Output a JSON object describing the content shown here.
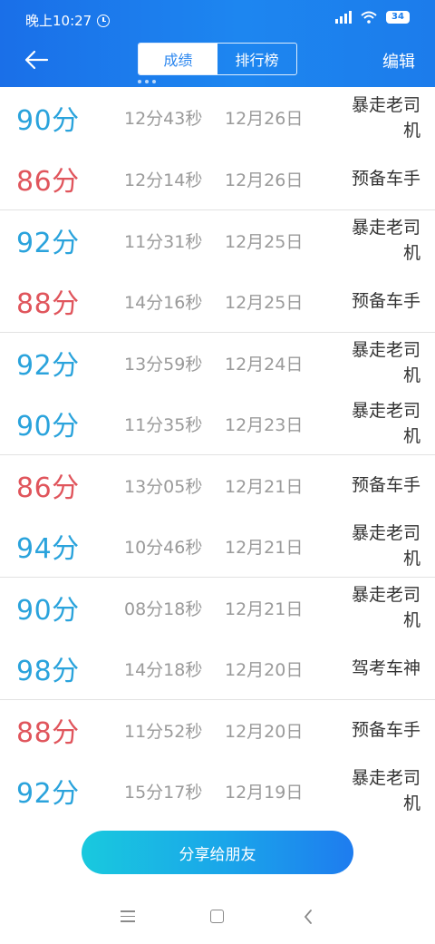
{
  "status_bar": {
    "time": "晚上10:27",
    "battery": "34"
  },
  "nav": {
    "tabs": [
      {
        "label": "成绩",
        "active": true
      },
      {
        "label": "排行榜",
        "active": false
      }
    ],
    "edit_label": "编辑"
  },
  "records": [
    {
      "score": "90分",
      "duration": "12分43秒",
      "date": "12月26日",
      "title": "暴走老司机",
      "color": "blue"
    },
    {
      "score": "86分",
      "duration": "12分14秒",
      "date": "12月26日",
      "title": "预备车手",
      "color": "red"
    },
    {
      "score": "92分",
      "duration": "11分31秒",
      "date": "12月25日",
      "title": "暴走老司机",
      "color": "blue"
    },
    {
      "score": "88分",
      "duration": "14分16秒",
      "date": "12月25日",
      "title": "预备车手",
      "color": "red"
    },
    {
      "score": "92分",
      "duration": "13分59秒",
      "date": "12月24日",
      "title": "暴走老司机",
      "color": "blue"
    },
    {
      "score": "90分",
      "duration": "11分35秒",
      "date": "12月23日",
      "title": "暴走老司机",
      "color": "blue"
    },
    {
      "score": "86分",
      "duration": "13分05秒",
      "date": "12月21日",
      "title": "预备车手",
      "color": "red"
    },
    {
      "score": "94分",
      "duration": "10分46秒",
      "date": "12月21日",
      "title": "暴走老司机",
      "color": "blue"
    },
    {
      "score": "90分",
      "duration": "08分18秒",
      "date": "12月21日",
      "title": "暴走老司机",
      "color": "blue"
    },
    {
      "score": "98分",
      "duration": "14分18秒",
      "date": "12月20日",
      "title": "驾考车神",
      "color": "blue"
    },
    {
      "score": "88分",
      "duration": "11分52秒",
      "date": "12月20日",
      "title": "预备车手",
      "color": "red"
    },
    {
      "score": "92分",
      "duration": "15分17秒",
      "date": "12月19日",
      "title": "暴走老司机",
      "color": "blue"
    }
  ],
  "share_label": "分享给朋友",
  "colors": {
    "header": "#1d86f0",
    "score_blue": "#2aa3dc",
    "score_red": "#e0555c",
    "share_start": "#19c9de",
    "share_end": "#1e7cef"
  },
  "icons": {
    "back": "arrow-left-icon",
    "alarm": "alarm-icon",
    "signal": "signal-icon",
    "wifi": "wifi-icon",
    "battery": "battery-icon",
    "menu": "menu-icon",
    "home": "home-icon",
    "system_back": "chevron-left-icon"
  }
}
